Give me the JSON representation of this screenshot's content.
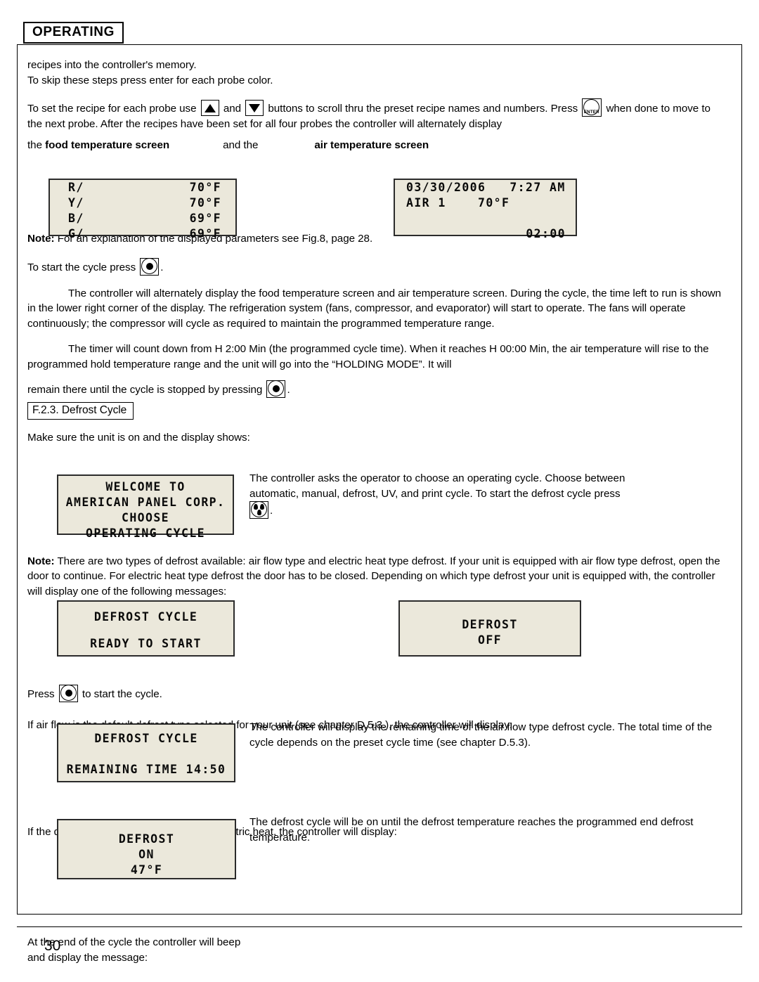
{
  "header": {
    "title": "OPERATING"
  },
  "body": {
    "p1_line1": "recipes into the controller's memory.",
    "p1_line2": "To skip these steps press enter for each probe color.",
    "p2_a": "To set the recipe for each probe use ",
    "p2_b": " and ",
    "p2_c": " buttons to scroll thru the preset recipe names and numbers. Press ",
    "p2_d": " when done to move to the next probe. After the recipes have been set for all four probes the controller will alternately display",
    "screens_label_a": "the ",
    "screens_label_food": "food temperature screen",
    "screens_label_mid": "and the",
    "screens_label_air": "air temperature screen",
    "note1_bold": "Note:",
    "note1_text": " For an explanation of the displayed parameters see Fig.8, page 28.",
    "start_cycle_a": "To start the cycle press ",
    "start_cycle_b": ".",
    "p3": "The controller will alternately display the food temperature screen and air temperature screen. During the cycle, the time left to run is shown in the lower right corner of the display. The refrigeration system (fans, compressor, and evaporator) will start to operate. The fans will operate continuously; the compressor will cycle as required to maintain the programmed temperature range.",
    "p4": "The timer will count down from H 2:00 Min (the programmed cycle time). When it reaches H 00:00 Min, the air temperature will rise to the programmed hold temperature range and the unit will go into the “HOLDING MODE”. It will",
    "p5_a": "remain there until the cycle is stopped by pressing ",
    "p5_b": ".",
    "section_chip": "F.2.3. Defrost Cycle",
    "p6": "Make sure the unit is on and the display shows:",
    "rc1_line1": "The controller asks the operator to choose an operating cycle. Choose between",
    "rc1_line2": "automatic, manual, defrost, UV, and print cycle. To start the defrost cycle press",
    "rc1_line3_suffix": ".",
    "note2_bold": "Note:",
    "note2_text": " There are two types of defrost available: air flow type and electric heat type defrost. If your unit is equipped with air flow type defrost, open the door to continue. For electric heat type defrost the door has to be closed. Depending on which type defrost your unit is equipped with, the controller will display one of the following messages:",
    "press_start_a": "Press ",
    "press_start_b": " to start the cycle.",
    "p7": "If air flow is the default defrost type selected for your unit (see chapter D.5.3.), the controller will display:",
    "rc2": "The controller will display the remaining time of the air flow type defrost cycle. The total time of the cycle depends on the preset cycle time (see chapter D.5.3).",
    "p8": "If the default defrost type for your unit is electric heat, the controller will display:",
    "rc3": "The defrost cycle will be on until the defrost temperature reaches the programmed end defrost temperature.",
    "p9_line1": "At the end of the cycle the controller will beep",
    "p9_line2": "and display the message:"
  },
  "lcd_food": {
    "rows": [
      {
        "label": "R/",
        "value": "70°F"
      },
      {
        "label": "Y/",
        "value": "70°F"
      },
      {
        "label": "B/",
        "value": "69°F"
      },
      {
        "label": "G/",
        "value": "69°F"
      }
    ]
  },
  "lcd_air": {
    "line1": "03/30/2006   7:27 AM",
    "line2": "AIR 1    70°F",
    "line4": "02:00"
  },
  "lcd_welcome": {
    "line1": "WELCOME TO",
    "line2": "AMERICAN PANEL CORP.",
    "line3": "CHOOSE",
    "line4": "OPERATING CYCLE"
  },
  "lcd_defrost_ready": {
    "line1": "DEFROST CYCLE",
    "line2": "READY TO START"
  },
  "lcd_defrost_off": {
    "line1": "DEFROST",
    "line2": "OFF"
  },
  "lcd_remaining": {
    "line1": "DEFROST CYCLE",
    "line2": "REMAINING TIME 14:50"
  },
  "lcd_defrost_on": {
    "line1": "DEFROST",
    "line2": "ON",
    "line3": "47°F"
  },
  "footer": {
    "page_number": "30"
  },
  "icons": {
    "up": "arrow-up-button",
    "down": "arrow-down-button",
    "enter": "ENTER",
    "start": "start-stop-button",
    "defrost": "defrost-droplets-button"
  },
  "colors": {
    "lcd_background": "#ebe8db",
    "lcd_border": "#2b2b2b",
    "text": "#000000"
  }
}
